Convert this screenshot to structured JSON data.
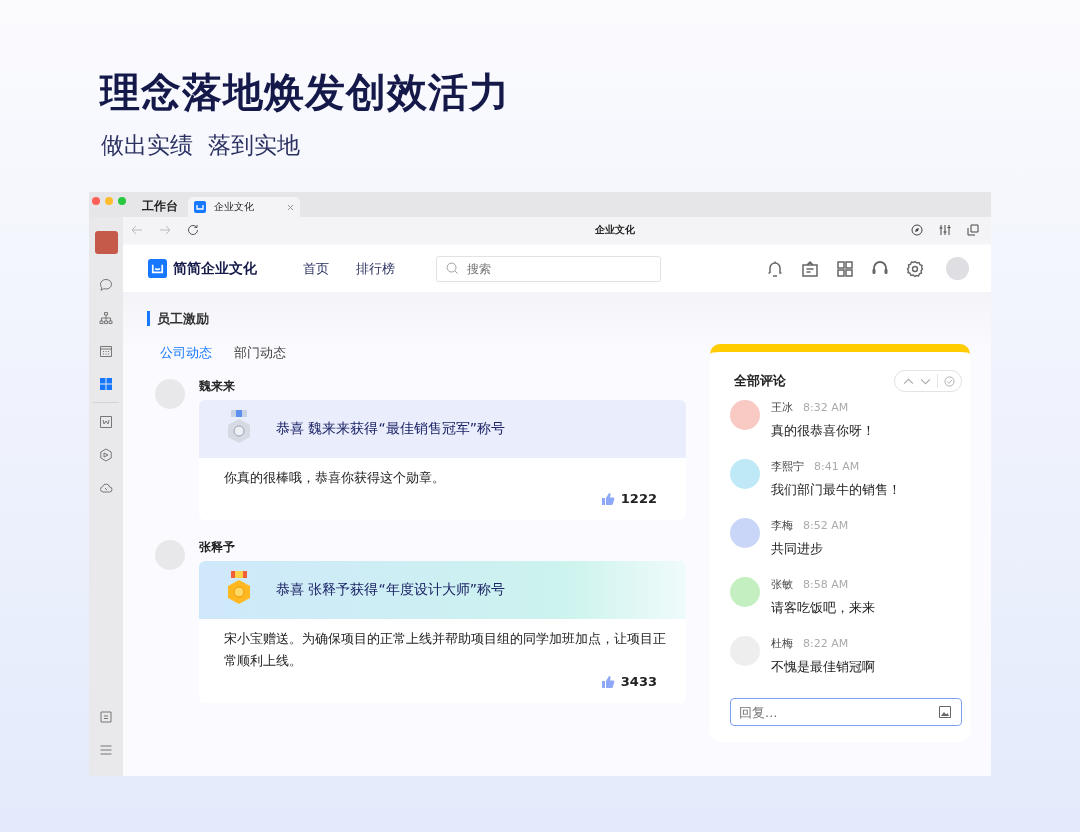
{
  "headline": "理念落地焕发创效活力",
  "subheadline": "做出实绩  落到实地",
  "window": {
    "workspace_label": "工作台",
    "tab_title": "企业文化",
    "address_title": "企业文化"
  },
  "sidebar": {
    "items": [
      {
        "kind": "chat",
        "selected": false
      },
      {
        "kind": "org",
        "selected": false
      },
      {
        "kind": "calendar",
        "selected": false
      },
      {
        "kind": "apps",
        "selected": true
      },
      {
        "kind": "doc",
        "selected": false
      },
      {
        "kind": "hexagon",
        "selected": false
      },
      {
        "kind": "cloud",
        "selected": false
      }
    ]
  },
  "app": {
    "name": "简简企业文化",
    "nav": [
      "首页",
      "排行榜"
    ],
    "search": {
      "placeholder": "搜索"
    }
  },
  "section_title": "员工激励",
  "tabs": [
    {
      "label": "公司动态",
      "selected": true
    },
    {
      "label": "部门动态",
      "selected": false
    }
  ],
  "posts": [
    {
      "author": "魏来来",
      "kind": "silver",
      "award": "恭喜 魏来来获得“最佳销售冠军”称号",
      "message": "你真的很棒哦，恭喜你获得这个勋章。",
      "likes": "1222"
    },
    {
      "author": "张释予",
      "kind": "gold",
      "award": "恭喜 张释予获得“年度设计大师”称号",
      "message": "宋小宝赠送。为确保项目的正常上线并帮助项目组的同学加班加点，让项目正常顺利上线。",
      "likes": "3433"
    }
  ],
  "comments_panel": {
    "title": "全部评论",
    "reply": {
      "placeholder": "回复..."
    },
    "comments": [
      {
        "name": "王冰",
        "time": "8:32 AM",
        "text": "真的很恭喜你呀！",
        "color": "#f9c9c4"
      },
      {
        "name": "李熙宁",
        "time": "8:41 AM",
        "text": "我们部门最牛的销售！",
        "color": "#bfe9f7"
      },
      {
        "name": "李梅",
        "time": "8:52 AM",
        "text": "共同进步",
        "color": "#c9d6f7"
      },
      {
        "name": "张敏",
        "time": "8:58 AM",
        "text": "请客吃饭吧，来来",
        "color": "#c4efc0"
      },
      {
        "name": "杜梅",
        "time": "8:22 AM",
        "text": "不愧是最佳销冠啊",
        "color": "#eeeeee"
      }
    ]
  }
}
